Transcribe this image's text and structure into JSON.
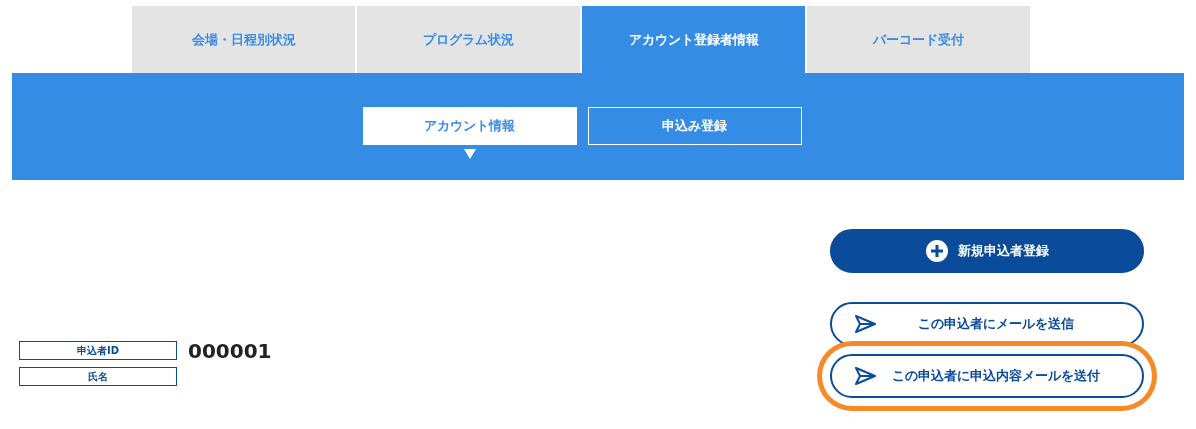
{
  "tabs": [
    {
      "label": "会場・日程別状況",
      "selected": false
    },
    {
      "label": "プログラム状況",
      "selected": false
    },
    {
      "label": "アカウント登録者情報",
      "selected": true
    },
    {
      "label": "バーコード受付",
      "selected": false
    }
  ],
  "subtabs": [
    {
      "label": "アカウント情報",
      "selected": true
    },
    {
      "label": "申込み登録",
      "selected": false
    }
  ],
  "actions": [
    {
      "kind": "primary",
      "label": "新規申込者登録",
      "highlighted": false
    },
    {
      "kind": "mail",
      "label": "この申込者にメールを送信",
      "highlighted": false
    },
    {
      "kind": "mail",
      "label": "この申込者に申込内容メールを送付",
      "highlighted": true
    }
  ],
  "fields": [
    {
      "label": "申込者ID",
      "value": "000001"
    },
    {
      "label": "氏名"
    }
  ]
}
